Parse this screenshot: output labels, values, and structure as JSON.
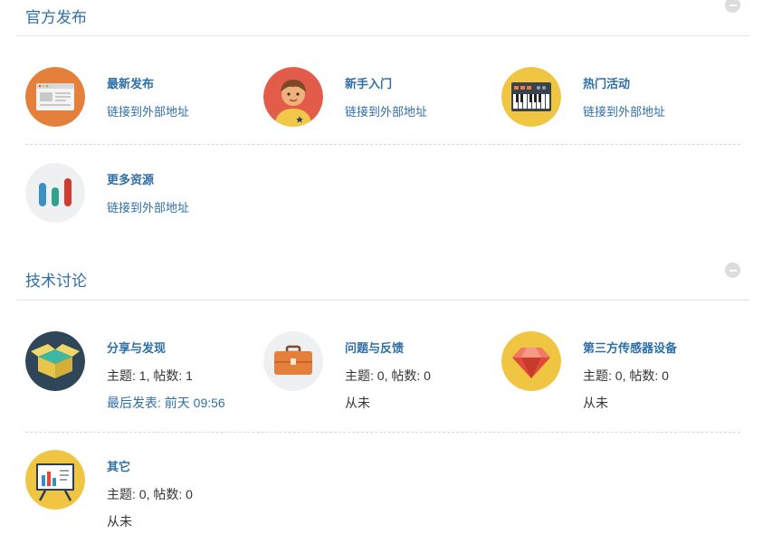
{
  "sections": [
    {
      "title": "官方发布",
      "forums": [
        {
          "name": "最新发布",
          "subtitle": "链接到外部地址",
          "icon": "browser-window-icon"
        },
        {
          "name": "新手入门",
          "subtitle": "链接到外部地址",
          "icon": "beginner-avatar-icon"
        },
        {
          "name": "热门活动",
          "subtitle": "链接到外部地址",
          "icon": "synthesizer-icon"
        },
        {
          "name": "更多资源",
          "subtitle": "链接到外部地址",
          "icon": "bar-chart-icon"
        }
      ]
    },
    {
      "title": "技术讨论",
      "forums": [
        {
          "name": "分享与发现",
          "stats": "主题: 1, 帖数: 1",
          "last_prefix": "最后发表: ",
          "last_time": "前天 09:56",
          "icon": "open-box-icon"
        },
        {
          "name": "问题与反馈",
          "stats": "主题: 0, 帖数: 0",
          "last_prefix": "从未",
          "last_time": "",
          "icon": "briefcase-icon"
        },
        {
          "name": "第三方传感器设备",
          "stats": "主题: 0, 帖数: 0",
          "last_prefix": "从未",
          "last_time": "",
          "icon": "gem-icon"
        },
        {
          "name": "其它",
          "stats": "主题: 0, 帖数: 0",
          "last_prefix": "从未",
          "last_time": "",
          "icon": "presentation-board-icon"
        }
      ]
    }
  ],
  "colors": {
    "link": "#2f6fa7",
    "text": "#333333",
    "divider": "#e3e3e3"
  }
}
